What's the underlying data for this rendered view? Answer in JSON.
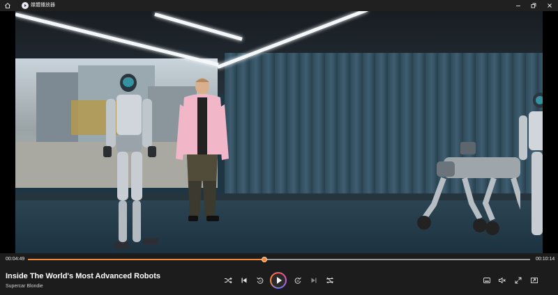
{
  "app": {
    "title": "媒體播放器"
  },
  "icons": {
    "home": "home-icon",
    "app": "media-player-icon",
    "minimize": "minimize-icon",
    "restore": "restore-icon",
    "close": "close-icon",
    "shuffle": "shuffle-icon",
    "previous": "previous-icon",
    "rewind": "rewind-10-icon",
    "play": "play-icon",
    "forward": "forward-30-icon",
    "next": "next-icon",
    "repeat": "repeat-off-icon",
    "miniplayer": "miniplayer-icon",
    "mute": "volume-muted-icon",
    "fullscreen": "fullscreen-icon",
    "cast": "cast-icon"
  },
  "playback": {
    "current_time": "00:04:49",
    "total_time": "00:10:14",
    "progress": 0.471
  },
  "media": {
    "title": "Inside The World's Most Advanced Robots",
    "channel": "Supercar Blondie"
  },
  "colors": {
    "accent": "#f08a3a",
    "background": "#1c1c1c",
    "titlebar": "#202020"
  }
}
